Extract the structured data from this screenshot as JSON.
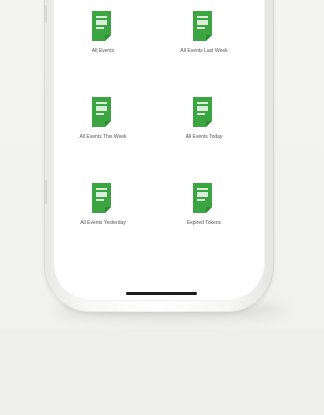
{
  "theme": {
    "icon_color": "#3aa541",
    "icon_dark": "#2b8d34",
    "icon_light": "#d8eed9"
  },
  "menu": {
    "items": [
      {
        "label": "All Events",
        "icon": "document-icon"
      },
      {
        "label": "All Events Last Week",
        "icon": "document-icon"
      },
      {
        "label": "All Events This Week",
        "icon": "document-icon"
      },
      {
        "label": "All Events Today",
        "icon": "document-icon"
      },
      {
        "label": "All Events Yesterday",
        "icon": "document-icon"
      },
      {
        "label": "Expired Tokens",
        "icon": "document-icon"
      }
    ]
  }
}
